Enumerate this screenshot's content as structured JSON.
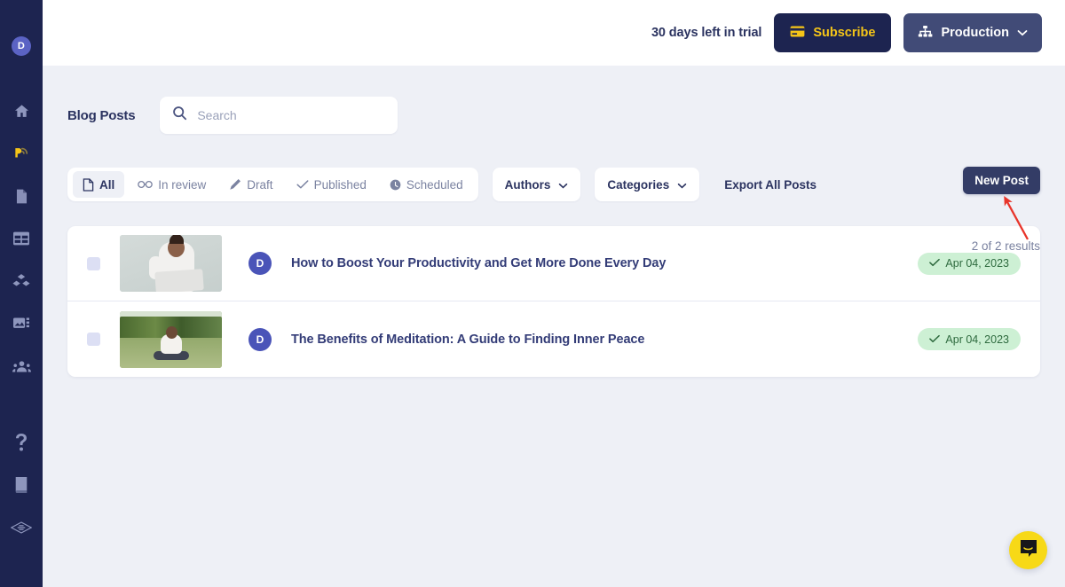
{
  "sidebar": {
    "avatar_label": "D",
    "items": [
      {
        "name": "home-icon",
        "label": "Home"
      },
      {
        "name": "blog-icon",
        "label": "Blog",
        "active": true
      },
      {
        "name": "page-icon",
        "label": "Pages"
      },
      {
        "name": "table-icon",
        "label": "Collections"
      },
      {
        "name": "components-icon",
        "label": "Components"
      },
      {
        "name": "media-icon",
        "label": "Media"
      },
      {
        "name": "audience-icon",
        "label": "Audience"
      },
      {
        "name": "help-icon",
        "label": "Help"
      },
      {
        "name": "book-icon",
        "label": "Docs"
      },
      {
        "name": "logo-icon",
        "label": "Logo"
      }
    ]
  },
  "topbar": {
    "trial_text": "30 days left in trial",
    "subscribe_label": "Subscribe",
    "subscribe_icon": "credit-card-icon",
    "environment_label": "Production",
    "environment_icon": "sitemap-icon",
    "chevron_icon": "chevron-down-icon"
  },
  "page": {
    "title": "Blog Posts",
    "new_post_label": "New Post",
    "results_count": "2 of 2 results"
  },
  "search": {
    "placeholder": "Search",
    "value": "",
    "icon": "search-icon"
  },
  "filters": {
    "tabs": [
      {
        "label": "All",
        "icon": "document-icon",
        "active": true
      },
      {
        "label": "In review",
        "icon": "glasses-icon",
        "active": false
      },
      {
        "label": "Draft",
        "icon": "pencil-icon",
        "active": false
      },
      {
        "label": "Published",
        "icon": "check-icon",
        "active": false
      },
      {
        "label": "Scheduled",
        "icon": "clock-icon",
        "active": false
      }
    ],
    "authors_label": "Authors",
    "categories_label": "Categories",
    "export_label": "Export All Posts"
  },
  "posts": [
    {
      "title": "How to Boost Your Productivity and Get More Done Every Day",
      "avatar": "D",
      "status_date": "Apr 04, 2023",
      "status_icon": "check-icon",
      "thumbnail": "woman-with-laptop"
    },
    {
      "title": "The Benefits of Meditation: A Guide to Finding Inner Peace",
      "avatar": "D",
      "status_date": "Apr 04, 2023",
      "status_icon": "check-icon",
      "thumbnail": "person-meditating-outdoors"
    }
  ],
  "chat": {
    "icon": "chat-bubble-icon"
  },
  "annotation": {
    "arrow_color": "#e8342a",
    "points_to": "New Post"
  },
  "colors": {
    "sidebar_bg": "#1d2450",
    "accent_yellow": "#f5c518",
    "page_bg": "#eef0f6",
    "badge_green_bg": "#cdf0d4",
    "badge_green_text": "#2f6b3f",
    "title_blue": "#333c77"
  }
}
